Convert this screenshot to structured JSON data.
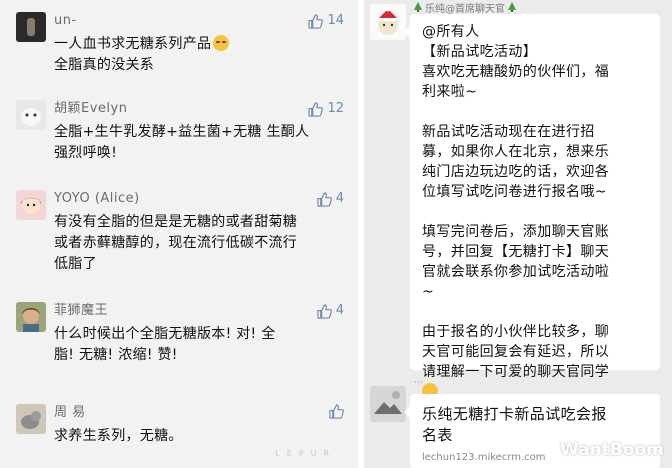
{
  "comments": [
    {
      "name": "un-",
      "likes": "14",
      "lines": [
        "一人血书求无糖系列产品",
        "全脂真的没关系"
      ],
      "has_emoji": true
    },
    {
      "name": "胡颖Evelyn",
      "likes": "12",
      "lines": [
        "全脂+生牛乳发酵+益生菌+无糖  生酮人",
        "强烈呼唤!"
      ]
    },
    {
      "name": "YOYO (Alice)",
      "likes": "4",
      "lines": [
        "有没有全脂的但是是无糖的或者甜菊糖",
        "或者赤藓糖醇的，现在流行低碳不流行",
        "低脂了"
      ]
    },
    {
      "name": "菲狮魔王",
      "likes": "4",
      "lines": [
        "什么时候出个全脂无糖版本! 对! 全",
        "脂! 无糖! 浓缩! 赞!"
      ]
    },
    {
      "name": "周 易",
      "likes": "",
      "lines": [
        "求养生系列，无糖。"
      ]
    }
  ],
  "left_watermark": "LEPUR",
  "chat": {
    "sender": "乐纯@首席聊天官",
    "message": [
      [
        "@所有人",
        "【新品试吃活动】",
        "喜欢吃无糖酸奶的伙伴们，福",
        "利来啦~"
      ],
      [
        "新品试吃活动现在在进行招",
        "募，如果你人在北京，想来乐",
        "纯门店边玩边吃的话，欢迎各",
        "位填写试吃问卷进行报名哦~"
      ],
      [
        "填写完问卷后，添加聊天官账",
        "号，并回复【无糖打卡】聊天",
        "官就会联系你参加试吃活动啦",
        "~"
      ],
      [
        "由于报名的小伙伴比较多，聊",
        "天官可能回复会有延迟，所以",
        "请理解一下可爱的聊天官同学"
      ]
    ],
    "link_title_lines": [
      "乐纯无糖打卡新品试吃会报",
      "名表"
    ],
    "link_url": "lechun123.mikecrm.com",
    "right_watermark": "WantBoom"
  }
}
